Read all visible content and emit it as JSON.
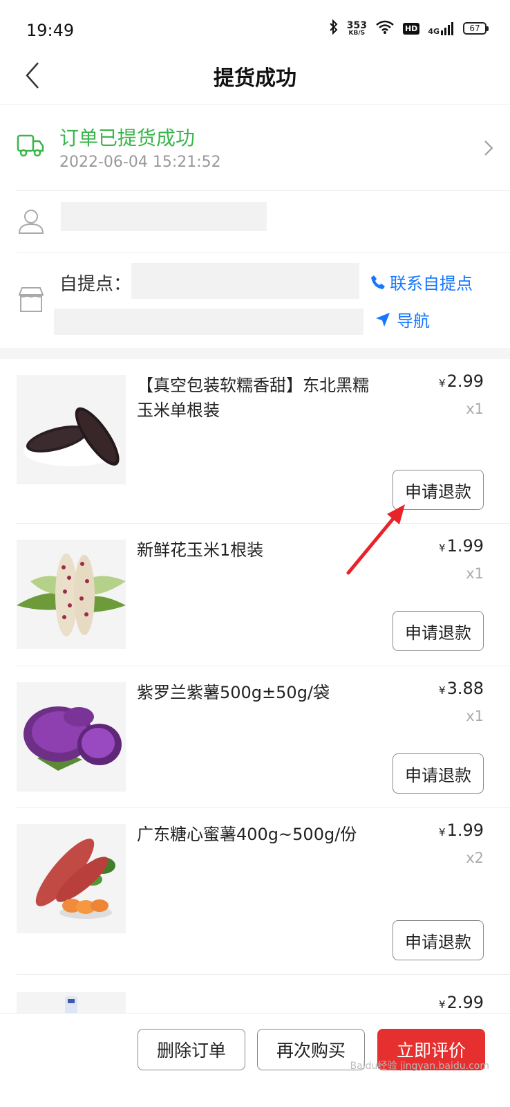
{
  "status_bar": {
    "time": "19:49",
    "net_speed_value": "353",
    "net_speed_unit": "KB/S",
    "hd": "HD",
    "network": "4G",
    "battery": "67"
  },
  "header": {
    "title": "提货成功"
  },
  "order_status": {
    "title": "订单已提货成功",
    "time": "2022-06-04 15:21:52",
    "accent": "#39b54a"
  },
  "pickup": {
    "label": "自提点：",
    "contact_label": "联系自提点",
    "navigate_label": "导航",
    "link_color": "#1677ff"
  },
  "products": [
    {
      "name": "【真空包装软糯香甜】东北黑糯玉米单根装",
      "currency": "¥",
      "price": "2.99",
      "qty": "x1",
      "refund_label": "申请退款"
    },
    {
      "name": "新鲜花玉米1根装",
      "currency": "¥",
      "price": "1.99",
      "qty": "x1",
      "refund_label": "申请退款"
    },
    {
      "name": "紫罗兰紫薯500g±50g/袋",
      "currency": "¥",
      "price": "3.88",
      "qty": "x1",
      "refund_label": "申请退款"
    },
    {
      "name": "广东糖心蜜薯400g~500g/份",
      "currency": "¥",
      "price": "1.99",
      "qty": "x2",
      "refund_label": "申请退款"
    },
    {
      "name": "",
      "currency": "¥",
      "price": "2.99",
      "qty": "",
      "refund_label": ""
    }
  ],
  "bottom_bar": {
    "delete_label": "删除订单",
    "rebuy_label": "再次购买",
    "review_label": "立即评价",
    "primary_color": "#e5302f"
  },
  "watermark": "Baidu经验 jingyan.baidu.com"
}
